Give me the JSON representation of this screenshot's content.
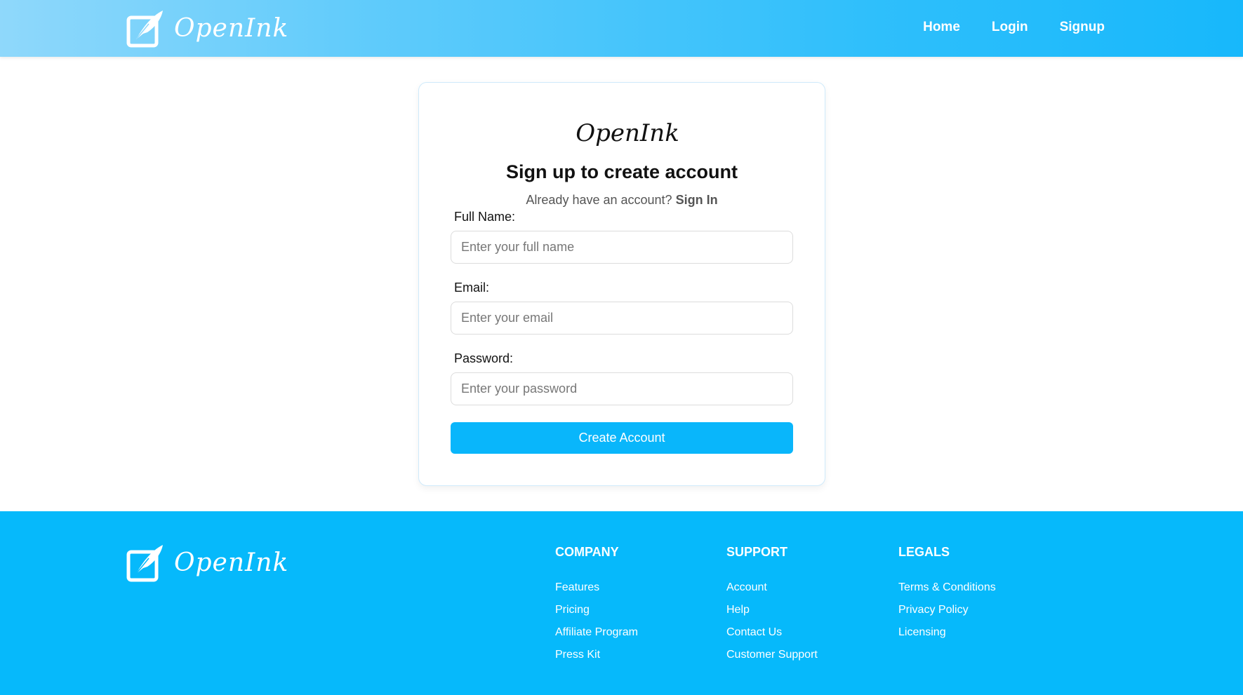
{
  "brand": {
    "name": "OpenInk"
  },
  "nav": {
    "items": [
      {
        "label": "Home"
      },
      {
        "label": "Login"
      },
      {
        "label": "Signup"
      }
    ]
  },
  "signup": {
    "logo_text": "OpenInk",
    "title": "Sign up to create account",
    "subtitle_prefix": "Already have an account?",
    "signin_link": "Sign In",
    "fields": [
      {
        "label": "Full Name:",
        "placeholder": "Enter your full name",
        "value": ""
      },
      {
        "label": "Email:",
        "placeholder": "Enter your email",
        "value": ""
      },
      {
        "label": "Password:",
        "placeholder": "Enter your password",
        "value": ""
      }
    ],
    "submit_label": "Create Account"
  },
  "footer": {
    "brand_name": "OpenInk",
    "columns": [
      {
        "heading": "COMPANY",
        "links": [
          "Features",
          "Pricing",
          "Affiliate Program",
          "Press Kit"
        ]
      },
      {
        "heading": "SUPPORT",
        "links": [
          "Account",
          "Help",
          "Contact Us",
          "Customer Support"
        ]
      },
      {
        "heading": "LEGALS",
        "links": [
          "Terms & Conditions",
          "Privacy Policy",
          "Licensing"
        ]
      }
    ]
  },
  "colors": {
    "accent": "#09b6fb",
    "footer_bg": "#06b9fb",
    "header_gradient_start": "#8fd8fb",
    "header_gradient_end": "#17b8fb"
  }
}
